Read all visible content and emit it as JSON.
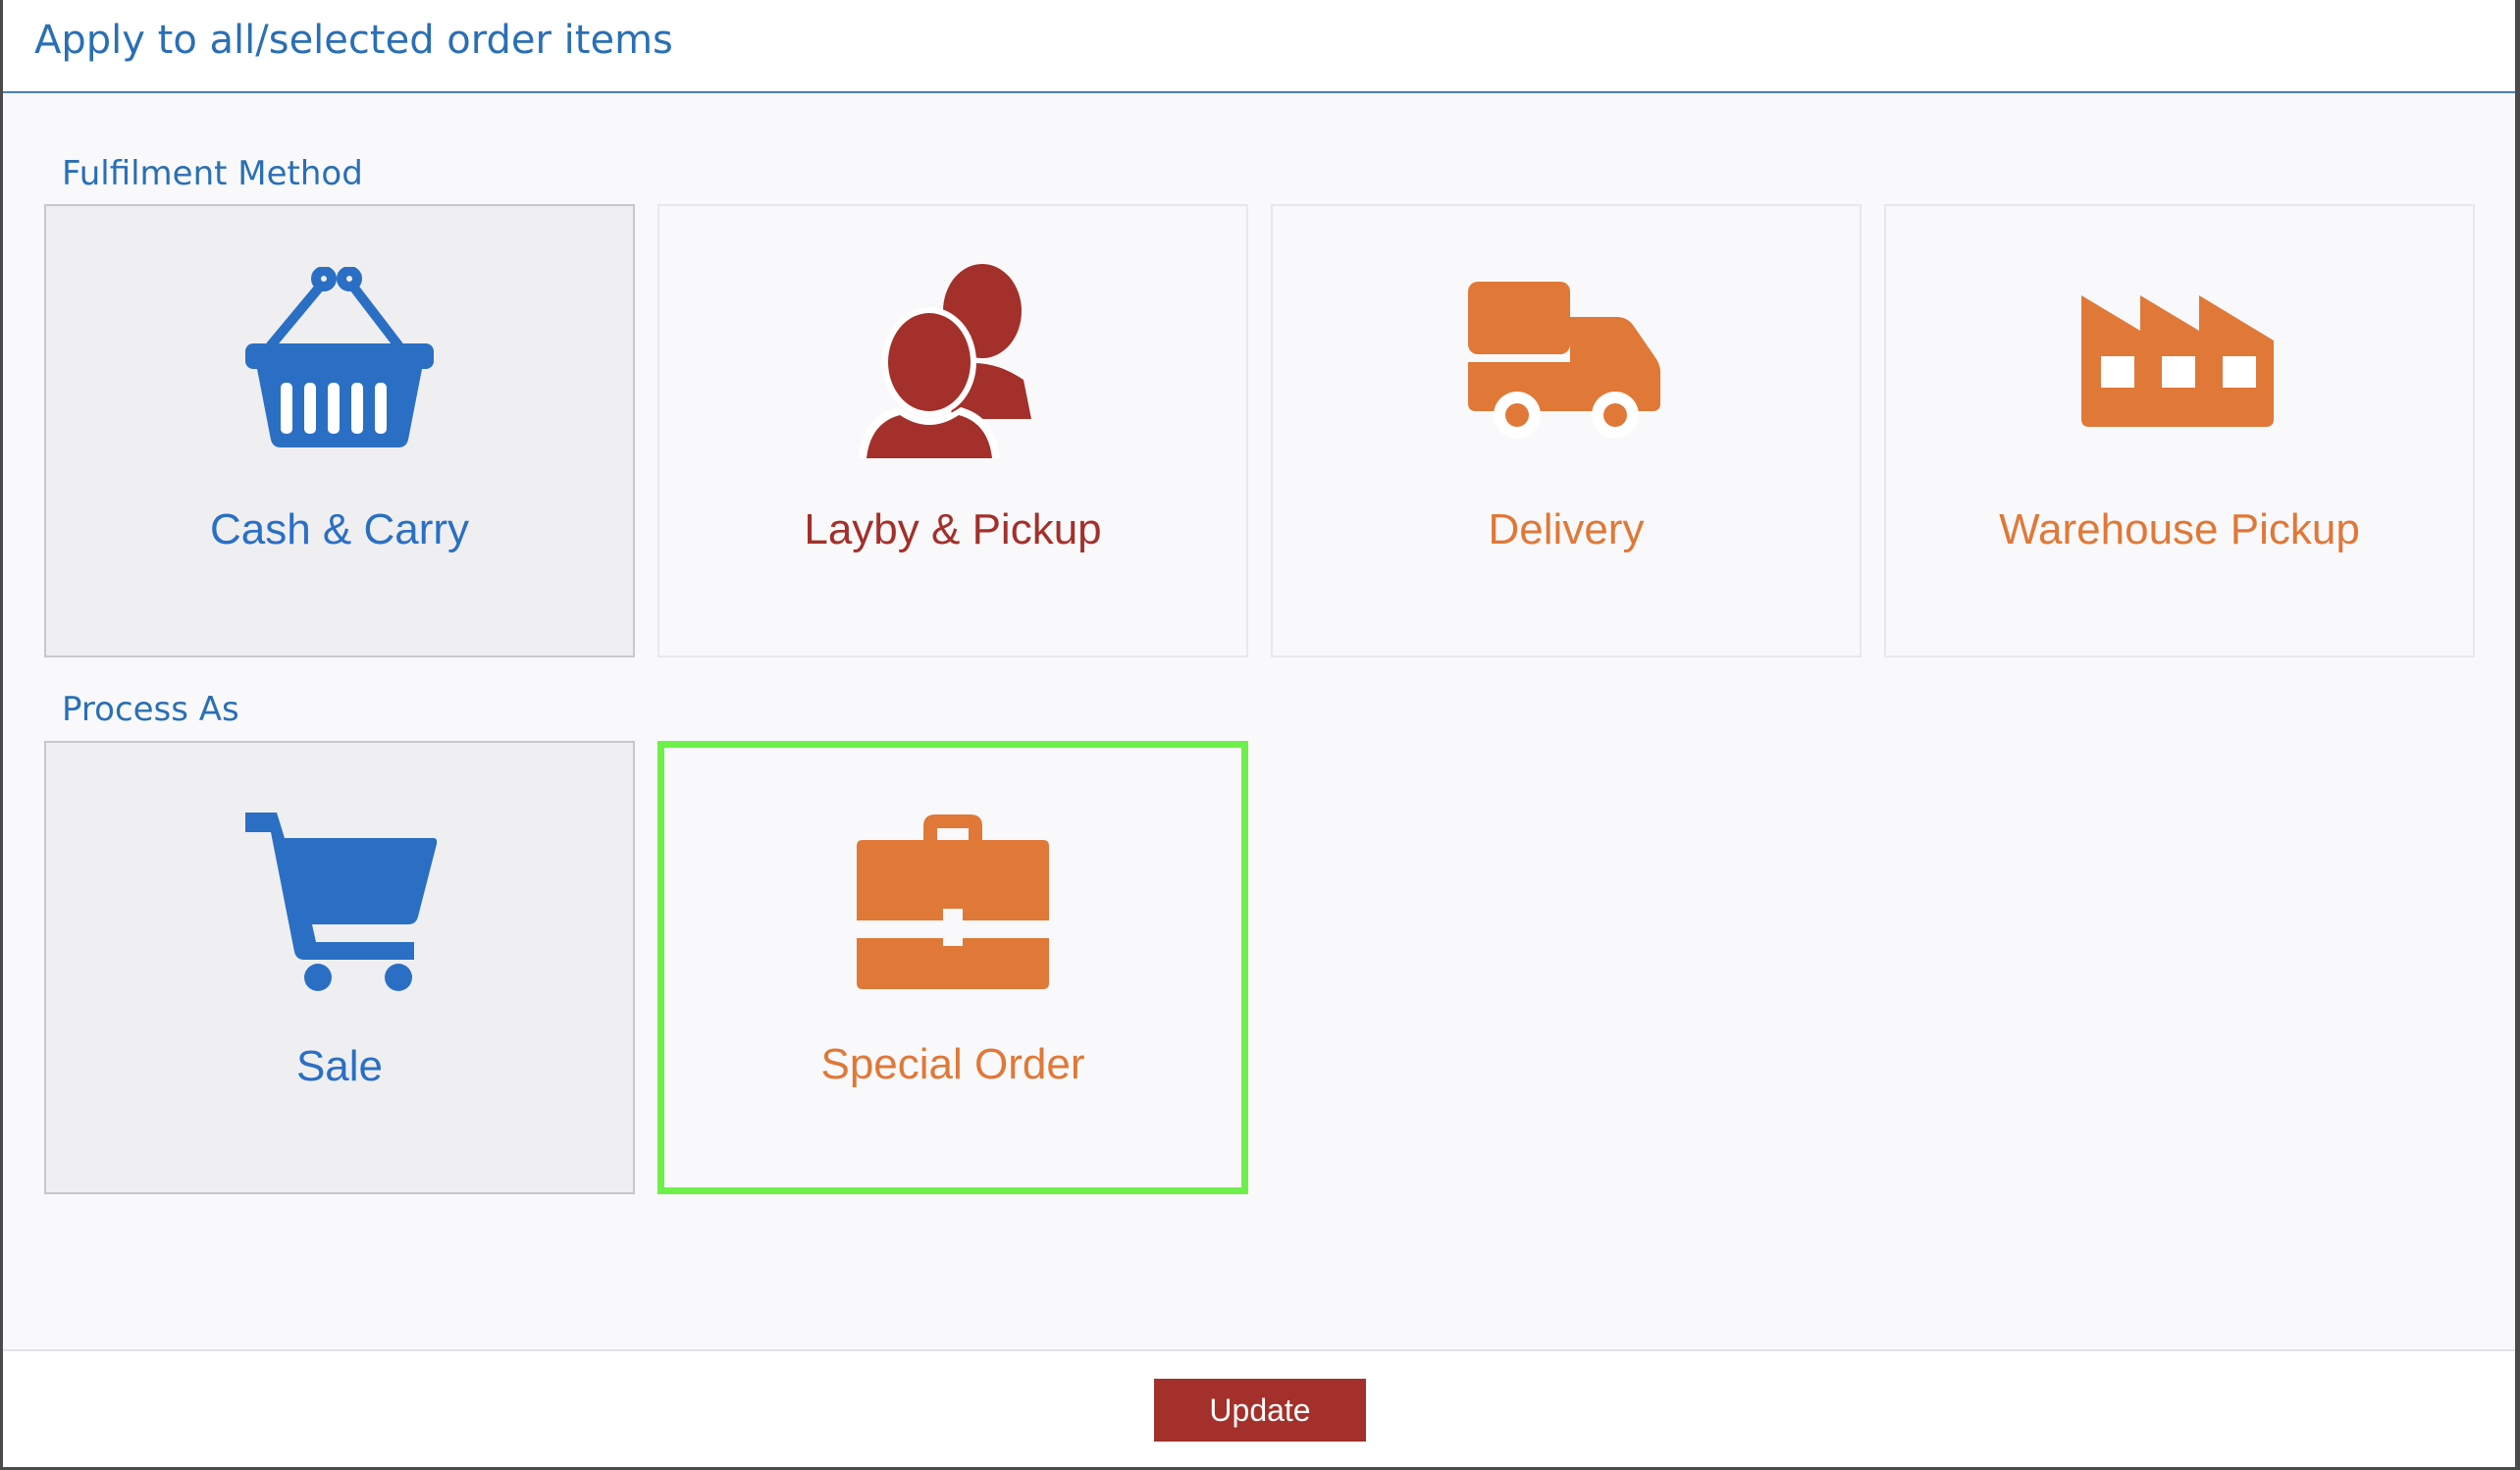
{
  "dialog": {
    "title": "Apply to all/selected order items"
  },
  "fulfilment": {
    "label": "Fulfilment Method",
    "options": [
      {
        "label": "Cash & Carry",
        "icon": "basket-icon",
        "color": "#2a6fc4",
        "selected": true
      },
      {
        "label": "Layby & Pickup",
        "icon": "people-icon",
        "color": "#a3302a",
        "selected": false
      },
      {
        "label": "Delivery",
        "icon": "truck-icon",
        "color": "#e07838",
        "selected": false
      },
      {
        "label": "Warehouse Pickup",
        "icon": "factory-icon",
        "color": "#e07838",
        "selected": false
      }
    ]
  },
  "process_as": {
    "label": "Process As",
    "options": [
      {
        "label": "Sale",
        "icon": "cart-icon",
        "color": "#2a6fc4",
        "selected": true
      },
      {
        "label": "Special Order",
        "icon": "briefcase-icon",
        "color": "#e07838",
        "selected": false,
        "highlighted": true
      }
    ]
  },
  "footer": {
    "update_label": "Update"
  },
  "colors": {
    "accent_blue": "#2a6fb5",
    "brand_red": "#a3302a",
    "orange": "#e07838",
    "highlight_green": "#6ef04a"
  }
}
